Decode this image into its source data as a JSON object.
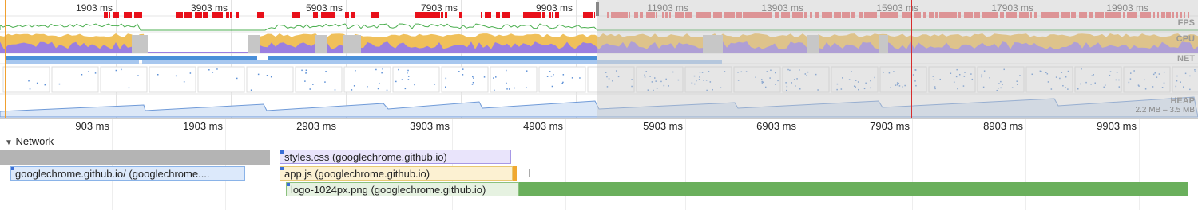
{
  "overview": {
    "top_ticks": [
      "1903 ms",
      "3903 ms",
      "5903 ms",
      "7903 ms",
      "9903 ms",
      "11903 ms",
      "13903 ms",
      "15903 ms",
      "17903 ms",
      "19903 ms"
    ],
    "lanes": {
      "fps": "FPS",
      "cpu": "CPU",
      "net": "NET",
      "heap": "HEAP"
    },
    "heap_range": "2.2 MB – 3.5 MB"
  },
  "ruler": {
    "ticks": [
      "903 ms",
      "1903 ms",
      "2903 ms",
      "3903 ms",
      "4903 ms",
      "5903 ms",
      "6903 ms",
      "7903 ms",
      "8903 ms",
      "9903 ms"
    ]
  },
  "network": {
    "header": "Network",
    "requests": [
      {
        "label": "styles.css (googlechrome.github.io)"
      },
      {
        "label": "googlechrome.github.io/ (googlechrome...."
      },
      {
        "label": "app.js (googlechrome.github.io)"
      },
      {
        "label": "logo-1024px.png (googlechrome.github.io)"
      }
    ]
  },
  "colors": {
    "fps_red": "#e8101a",
    "fps_green": "#4caf50",
    "cpu_yellow": "#f0c05a",
    "cpu_purple": "#9b7fe0",
    "net_blue": "#4a90d9",
    "net_light": "#a7c7ef",
    "heap_fill": "#dbe7f7",
    "heap_line": "#6f9ad8",
    "css_bg": "#e9e4fb",
    "js_bg": "#fcf1d2",
    "img_green": "#6aaf5c",
    "doc_bg": "#dce9fb",
    "marker_blue": "#1a4fa0",
    "marker_green": "#2e7d32",
    "marker_red": "#d62d2d",
    "marker_orange": "#f0a030"
  }
}
